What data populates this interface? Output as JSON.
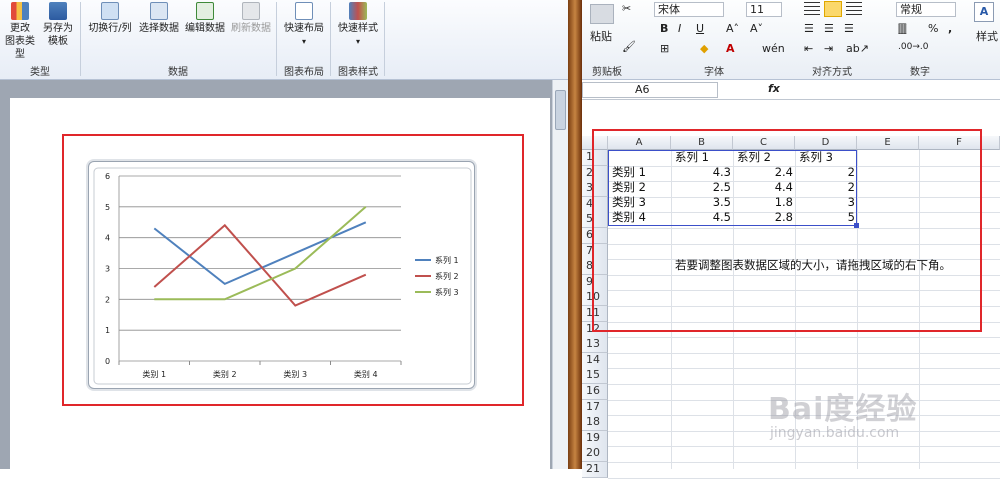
{
  "word": {
    "ribbon": {
      "buttons": [
        {
          "label": "更改\n图表类型",
          "icon": "chart-type-icon"
        },
        {
          "label": "另存为\n模板",
          "icon": "save-template-icon"
        },
        {
          "label": "切换行/列",
          "icon": "switch-row-col-icon"
        },
        {
          "label": "选择数据",
          "icon": "select-data-icon"
        },
        {
          "label": "编辑数据",
          "icon": "edit-data-icon"
        },
        {
          "label": "刷新数据",
          "icon": "refresh-data-icon"
        },
        {
          "label": "快速布局",
          "icon": "quick-layout-icon"
        },
        {
          "label": "快速样式",
          "icon": "quick-style-icon"
        }
      ],
      "groups": [
        "类型",
        "数据",
        "图表布局",
        "图表样式"
      ]
    }
  },
  "chart_data": {
    "type": "line",
    "categories": [
      "类别 1",
      "类别 2",
      "类别 3",
      "类别 4"
    ],
    "series": [
      {
        "name": "系列 1",
        "values": [
          4.3,
          2.5,
          3.5,
          4.5
        ],
        "color": "#4f81bd"
      },
      {
        "name": "系列 2",
        "values": [
          2.4,
          4.4,
          1.8,
          2.8
        ],
        "color": "#c0504d"
      },
      {
        "name": "系列 3",
        "values": [
          2,
          2,
          3,
          5
        ],
        "color": "#9bbb59"
      }
    ],
    "yticks": [
      "0",
      "1",
      "2",
      "3",
      "4",
      "5",
      "6"
    ],
    "ylim": [
      0,
      6
    ],
    "grid": true,
    "legend": "right"
  },
  "excel": {
    "ribbon": {
      "paste_label": "粘贴",
      "font_name": "宋体",
      "font_size": "11",
      "number_format": "常规",
      "percent": "%",
      "comma": ",",
      "style_label": "样式",
      "groups": [
        "剪贴板",
        "字体",
        "对齐方式",
        "数字"
      ]
    },
    "name_box": "A6",
    "fx": "fx",
    "columns": [
      "A",
      "B",
      "C",
      "D",
      "E",
      "F"
    ],
    "rows": [
      "1",
      "2",
      "3",
      "4",
      "5",
      "6",
      "7",
      "8",
      "9",
      "10",
      "11",
      "12",
      "13",
      "14",
      "15",
      "16",
      "17",
      "18",
      "19",
      "20",
      "21"
    ],
    "table": {
      "header": [
        "",
        "系列 1",
        "系列 2",
        "系列 3"
      ],
      "rows": [
        [
          "类别 1",
          "4.3",
          "2.4",
          "2"
        ],
        [
          "类别 2",
          "2.5",
          "4.4",
          "2"
        ],
        [
          "类别 3",
          "3.5",
          "1.8",
          "3"
        ],
        [
          "类别 4",
          "4.5",
          "2.8",
          "5"
        ]
      ]
    },
    "note": "若要调整图表数据区域的大小，请拖拽区域的右下角。"
  },
  "watermark": {
    "main": "Bai度经验",
    "sub": "jingyan.baidu.com"
  }
}
